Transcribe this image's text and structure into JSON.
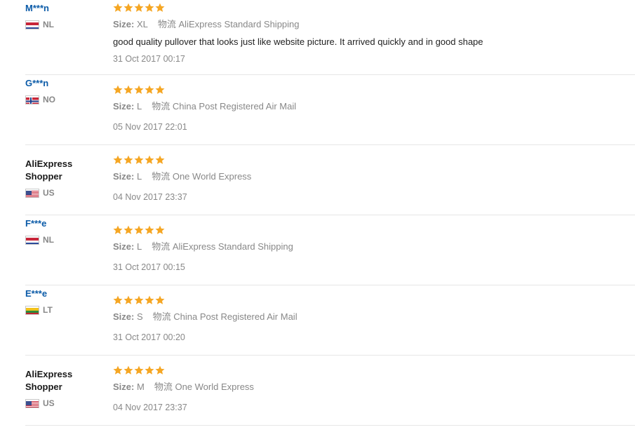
{
  "labels": {
    "size": "Size:",
    "logistics": "物流"
  },
  "reviews": [
    {
      "user": "M***n",
      "user_link": true,
      "country": "NL",
      "flag": "nl",
      "size": "XL",
      "show_logistics_label": false,
      "shipping": "AliExpress Standard Shipping",
      "text": "good quality pullover that looks just like website picture. It arrived quickly and in good shape",
      "date": "31 Oct 2017 00:17",
      "stars": 5
    },
    {
      "user": "G***n",
      "user_link": true,
      "country": "NO",
      "flag": "no",
      "size": "L",
      "show_logistics_label": true,
      "shipping": "China Post Registered Air Mail",
      "text": "",
      "date": "05 Nov 2017 22:01",
      "stars": 5
    },
    {
      "user": "AliExpress Shopper",
      "user_link": false,
      "country": "US",
      "flag": "us",
      "size": "L",
      "show_logistics_label": true,
      "shipping": "One World Express",
      "text": "",
      "date": "04 Nov 2017 23:37",
      "stars": 5
    },
    {
      "user": "F***e",
      "user_link": true,
      "country": "NL",
      "flag": "nl",
      "size": "L",
      "show_logistics_label": true,
      "shipping": "AliExpress Standard Shipping",
      "text": "",
      "date": "31 Oct 2017 00:15",
      "stars": 5
    },
    {
      "user": "E***e",
      "user_link": true,
      "country": "LT",
      "flag": "lt",
      "size": "S",
      "show_logistics_label": true,
      "shipping": "China Post Registered Air Mail",
      "text": "",
      "date": "31 Oct 2017 00:20",
      "stars": 5
    },
    {
      "user": "AliExpress Shopper",
      "user_link": false,
      "country": "US",
      "flag": "us",
      "size": "M",
      "show_logistics_label": true,
      "shipping": "One World Express",
      "text": "",
      "date": "04 Nov 2017 23:37",
      "stars": 5
    }
  ]
}
